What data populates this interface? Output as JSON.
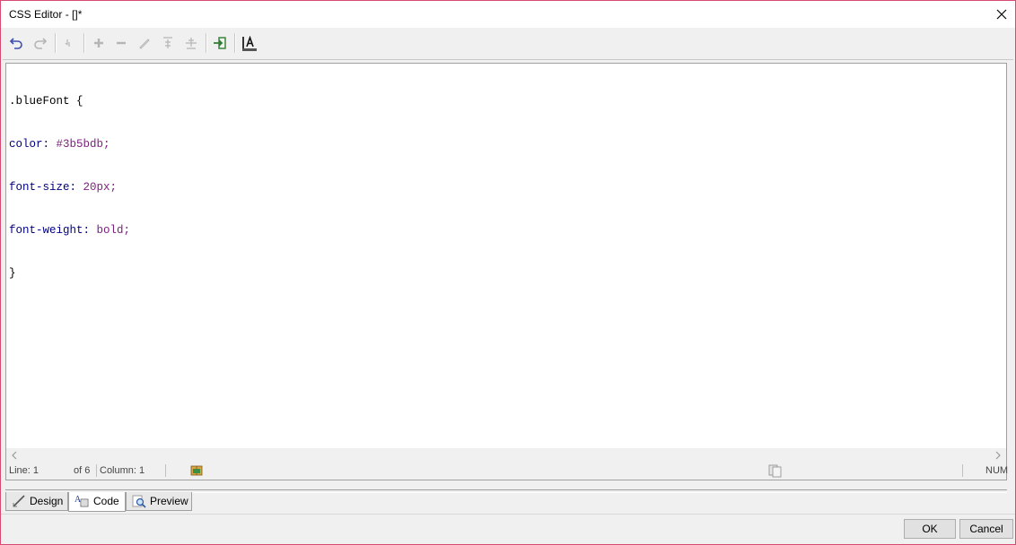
{
  "window": {
    "title": "CSS Editor - []*",
    "close_label": "Close"
  },
  "toolbar": {
    "buttons": [
      "undo-icon",
      "redo-icon",
      "wrap-icon",
      "add-icon",
      "remove-icon",
      "edit-icon",
      "move-up-icon",
      "move-down-icon",
      "import-icon",
      "font-style-icon"
    ]
  },
  "editor": {
    "lines": [
      {
        "selector": ".blueFont {"
      },
      {
        "prop": "color:",
        "val": " #3b5bdb;"
      },
      {
        "prop": "font-size:",
        "val": " 20px;"
      },
      {
        "prop": "font-weight:",
        "val": " bold;"
      },
      {
        "selector": "}"
      }
    ]
  },
  "status": {
    "line": "Line: 1",
    "of": "of 6",
    "column": "Column: 1",
    "num": "NUM"
  },
  "tabs": [
    {
      "label": "Design",
      "icon": "design-icon"
    },
    {
      "label": "Code",
      "icon": "code-icon",
      "active": true
    },
    {
      "label": "Preview",
      "icon": "preview-icon"
    }
  ],
  "buttons": {
    "ok": "OK",
    "cancel": "Cancel"
  },
  "colors": {
    "window_border": "#d64a73",
    "property": "#000080",
    "value": "#7a1e7a"
  }
}
